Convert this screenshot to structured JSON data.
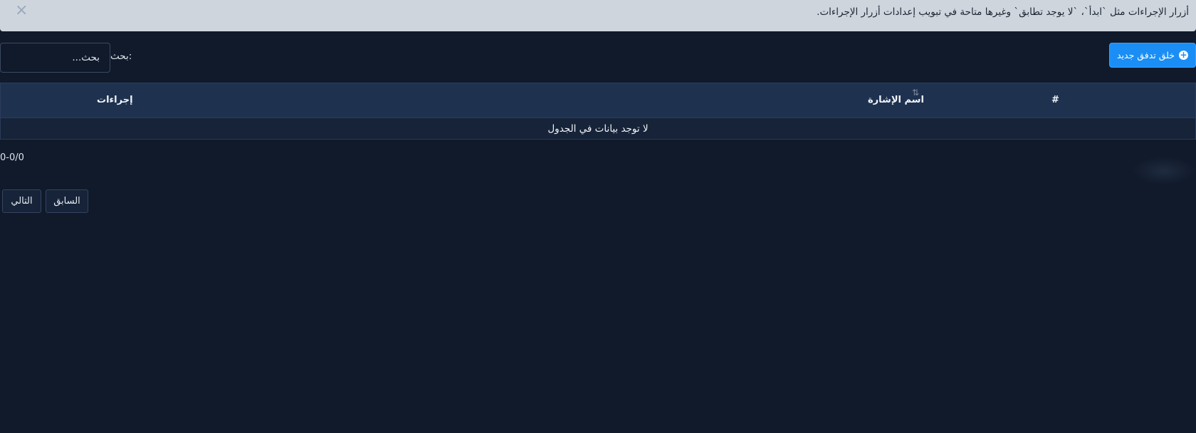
{
  "notice": {
    "text": "أزرار الإجراءات مثل `ابدأ`، `لا يوجد تطابق` وغيرها متاحة في تبويب إعدادات أزرار الإجراءات.",
    "close_icon": "×"
  },
  "toolbar": {
    "create_label": "خلق تدفق جديد",
    "create_icon": "+",
    "search_label": "بحث:",
    "search_placeholder": "بحث..."
  },
  "table": {
    "columns": [
      "#",
      "اسم الإشارة",
      "إجراءات"
    ],
    "sort_icon": "⇅",
    "empty_message": "لا توجد بيانات في الجدول"
  },
  "pagination": {
    "info": "0-0/0",
    "prev_label": "السابق",
    "next_label": "التالي"
  },
  "colors": {
    "background": "#101a2b",
    "accent": "#1a8ef5",
    "header": "#1e3250"
  }
}
